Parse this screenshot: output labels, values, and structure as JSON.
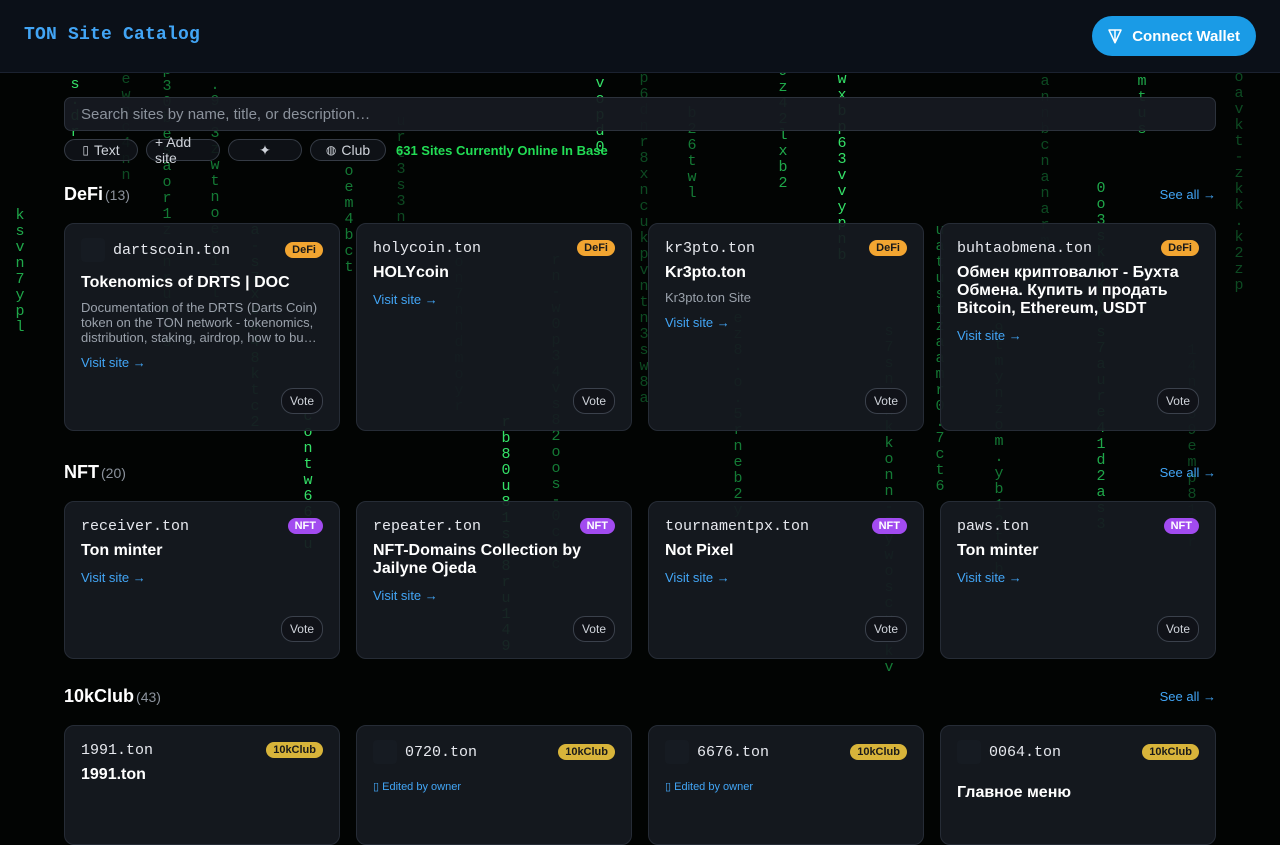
{
  "header": {
    "logo": "TON Site Catalog",
    "connect_label": "Connect Wallet"
  },
  "search": {
    "placeholder": "Search sites by name, title, or description…"
  },
  "chips": {
    "text": "Text",
    "add_site": "+ Add site",
    "sparkle": "✦",
    "club": "Club"
  },
  "online_status": "631 Sites Currently Online In Base",
  "see_all": "See all →",
  "vote_label": "Vote",
  "visit_label": "Visit site →",
  "edited_label": "Edited by owner",
  "sections": [
    {
      "name": "DeFi",
      "count": "(13)",
      "cards": [
        {
          "domain": "dartscoin.ton",
          "badge": "DeFi",
          "title": "Tokenomics of DRTS | DOC",
          "description": "Documentation of the DRTS (Darts Coin) token on the TON network - tokenomics, distribution, staking, airdrop, how to bu…"
        },
        {
          "domain": "holycoin.ton",
          "badge": "DeFi",
          "title": "HOLYcoin",
          "description": ""
        },
        {
          "domain": "kr3pto.ton",
          "badge": "DeFi",
          "title": "Kr3pto.ton",
          "description": "Kr3pto.ton Site"
        },
        {
          "domain": "buhtaobmena.ton",
          "badge": "DeFi",
          "title": "Обмен криптовалют - Бухта Обмена. Купить и продать Bitcoin, Ethereum, USDT",
          "description": ""
        }
      ]
    },
    {
      "name": "NFT",
      "count": "(20)",
      "cards": [
        {
          "domain": "receiver.ton",
          "badge": "NFT",
          "title": "Ton minter"
        },
        {
          "domain": "repeater.ton",
          "badge": "NFT",
          "title": "NFT-Domains Collection by Jailyne Ojeda"
        },
        {
          "domain": "tournamentpx.ton",
          "badge": "NFT",
          "title": "Not Pixel"
        },
        {
          "domain": "paws.ton",
          "badge": "NFT",
          "title": "Ton minter"
        }
      ]
    },
    {
      "name": "10kClub",
      "count": "(43)",
      "cards": [
        {
          "domain": "1991.ton",
          "badge": "10kClub",
          "title": "1991.ton"
        },
        {
          "domain": "0720.ton",
          "badge": "10kClub",
          "title": ""
        },
        {
          "domain": "6676.ton",
          "badge": "10kClub",
          "title": ""
        },
        {
          "domain": "0064.ton",
          "badge": "10kClub",
          "title": "Главное меню"
        }
      ]
    }
  ]
}
